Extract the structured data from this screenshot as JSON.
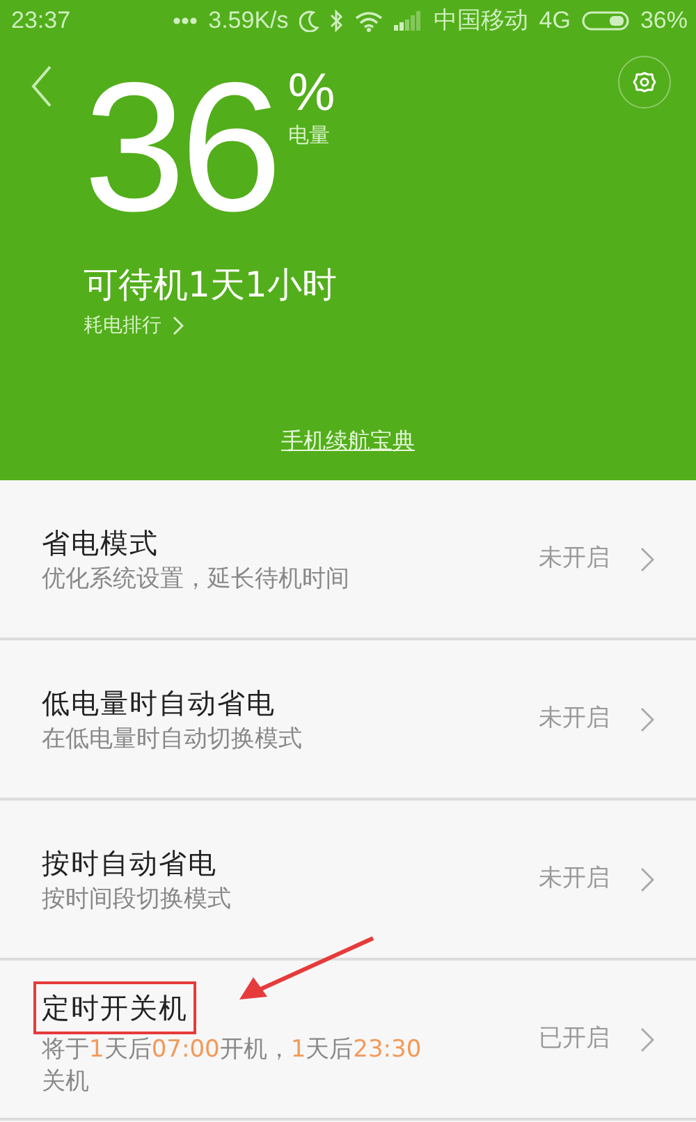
{
  "status_bar": {
    "time": "23:37",
    "speed": "3.59K/s",
    "carrier": "中国移动",
    "network": "4G",
    "battery": "36%"
  },
  "header": {
    "level_value": "36",
    "percent_sign": "%",
    "level_label": "电量",
    "standby": "可待机1天1小时",
    "ranking_link": "耗电排行",
    "guide_link": "手机续航宝典"
  },
  "rows": [
    {
      "title": "省电模式",
      "subtitle": [
        {
          "text": "优化系统设置，延长待机时间",
          "highlight": false
        }
      ],
      "status": "未开启",
      "annotated": false
    },
    {
      "title": "低电量时自动省电",
      "subtitle": [
        {
          "text": "在低电量时自动切换模式",
          "highlight": false
        }
      ],
      "status": "未开启",
      "annotated": false
    },
    {
      "title": "按时自动省电",
      "subtitle": [
        {
          "text": "按时间段切换模式",
          "highlight": false
        }
      ],
      "status": "未开启",
      "annotated": false
    },
    {
      "title": "定时开关机",
      "subtitle": [
        {
          "text": "将于",
          "highlight": false
        },
        {
          "text": "1",
          "highlight": true
        },
        {
          "text": "天后",
          "highlight": false
        },
        {
          "text": "07:00",
          "highlight": true
        },
        {
          "text": "开机，",
          "highlight": false
        },
        {
          "text": "1",
          "highlight": true
        },
        {
          "text": "天后",
          "highlight": false
        },
        {
          "text": "23:30",
          "highlight": true
        },
        {
          "text": "关机",
          "highlight": false
        }
      ],
      "status": "已开启",
      "annotated": true
    }
  ]
}
